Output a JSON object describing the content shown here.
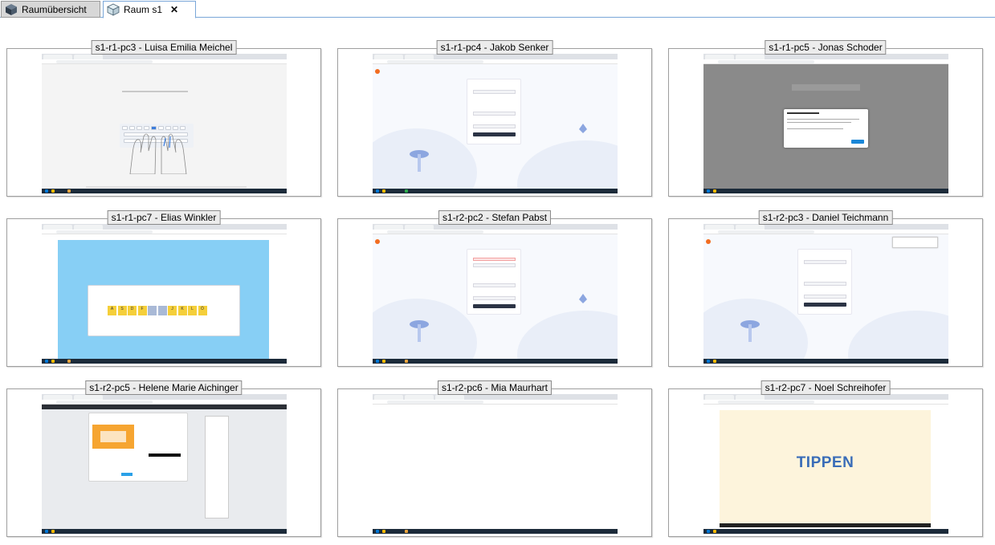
{
  "tabs": [
    {
      "label": "Raumübersicht",
      "icon": "cube-icon",
      "active": false
    },
    {
      "label": "Raum s1",
      "icon": "cube-outline-icon",
      "active": true,
      "close": "✕"
    }
  ],
  "computers": [
    {
      "caption": "s1-r1-pc3 - Luisa Emilia Meichel",
      "screen": "typing-hands"
    },
    {
      "caption": "s1-r1-pc4 - Jakob Senker",
      "screen": "edclub-login"
    },
    {
      "caption": "s1-r1-pc5 - Jonas Schoder",
      "screen": "settings-dialog"
    },
    {
      "caption": "s1-r1-pc7 - Elias Winkler",
      "screen": "blue-keyboard"
    },
    {
      "caption": "s1-r2-pc2 - Stefan Pabst",
      "screen": "edclub-login-error"
    },
    {
      "caption": "s1-r2-pc3 - Daniel Teichmann",
      "screen": "edclub-login-menu"
    },
    {
      "caption": "s1-r2-pc5 - Helene Marie Aichinger",
      "screen": "typingclub-lessonplans"
    },
    {
      "caption": "s1-r2-pc6 - Mia Maurhart",
      "screen": "blank"
    },
    {
      "caption": "s1-r2-pc7 - Noel Schreihofer",
      "screen": "tippen-video"
    }
  ],
  "screen_text": {
    "tippen": "TIPPEN",
    "blue_keyboard_home_row": [
      "A",
      "S",
      "D",
      "F",
      "",
      "",
      "J",
      "K",
      "L",
      "Ö"
    ]
  },
  "colors": {
    "tab_border": "#7aa7d8",
    "edclub_orange": "#f26d21",
    "keyboard_blue": "#87cff5",
    "key_yellow": "#f5cf3a",
    "tippen_bg": "#fdf4dc",
    "tippen_text": "#3a6db8"
  }
}
